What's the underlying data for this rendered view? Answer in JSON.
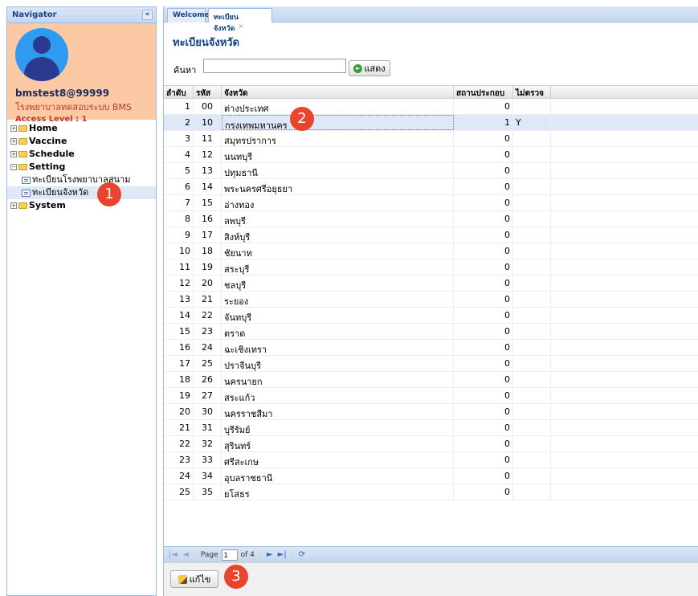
{
  "nav": {
    "title": "Navigator",
    "collapse_icon": "«",
    "username": "bmstest8@99999",
    "hospital": "โรงพยาบาลทดสอบระบบ BMS",
    "access": "Access Level : 1",
    "items": [
      {
        "label": "Home",
        "expanded": false
      },
      {
        "label": "Vaccine",
        "expanded": false
      },
      {
        "label": "Schedule",
        "expanded": false
      },
      {
        "label": "Setting",
        "expanded": true
      },
      {
        "label": "System",
        "expanded": false
      }
    ],
    "setting_children": [
      "ทะเบียนโรงพยาบาลสนาม",
      "ทะเบียนจังหวัด"
    ]
  },
  "tabs": [
    {
      "label": "Welcome"
    },
    {
      "label": "ทะเบียนจังหวัด",
      "close": "×"
    }
  ],
  "page": {
    "title": "ทะเบียนจังหวัด",
    "search_label": "ค้นหา",
    "search_value": "",
    "show_button": "แสดง"
  },
  "grid": {
    "headers": [
      "ลำดับ",
      "รหัส",
      "จังหวัด",
      "สถานประกอบ",
      "ไม่ตรวจ"
    ],
    "rows": [
      [
        "1",
        "00",
        "ต่างประเทศ",
        "0",
        ""
      ],
      [
        "2",
        "10",
        "กรุงเทพมหานคร",
        "1",
        "Y"
      ],
      [
        "3",
        "11",
        "สมุทรปราการ",
        "0",
        ""
      ],
      [
        "4",
        "12",
        "นนทบุรี",
        "0",
        ""
      ],
      [
        "5",
        "13",
        "ปทุมธานี",
        "0",
        ""
      ],
      [
        "6",
        "14",
        "พระนครศรีอยุธยา",
        "0",
        ""
      ],
      [
        "7",
        "15",
        "อ่างทอง",
        "0",
        ""
      ],
      [
        "8",
        "16",
        "ลพบุรี",
        "0",
        ""
      ],
      [
        "9",
        "17",
        "สิงห์บุรี",
        "0",
        ""
      ],
      [
        "10",
        "18",
        "ชัยนาท",
        "0",
        ""
      ],
      [
        "11",
        "19",
        "สระบุรี",
        "0",
        ""
      ],
      [
        "12",
        "20",
        "ชลบุรี",
        "0",
        ""
      ],
      [
        "13",
        "21",
        "ระยอง",
        "0",
        ""
      ],
      [
        "14",
        "22",
        "จันทบุรี",
        "0",
        ""
      ],
      [
        "15",
        "23",
        "ตราด",
        "0",
        ""
      ],
      [
        "16",
        "24",
        "ฉะเชิงเทรา",
        "0",
        ""
      ],
      [
        "17",
        "25",
        "ปราจีนบุรี",
        "0",
        ""
      ],
      [
        "18",
        "26",
        "นครนายก",
        "0",
        ""
      ],
      [
        "19",
        "27",
        "สระแก้ว",
        "0",
        ""
      ],
      [
        "20",
        "30",
        "นครราชสีมา",
        "0",
        ""
      ],
      [
        "21",
        "31",
        "บุรีรัมย์",
        "0",
        ""
      ],
      [
        "22",
        "32",
        "สุรินทร์",
        "0",
        ""
      ],
      [
        "23",
        "33",
        "ศรีสะเกษ",
        "0",
        ""
      ],
      [
        "24",
        "34",
        "อุบลราชธานี",
        "0",
        ""
      ],
      [
        "25",
        "35",
        "ยโสธร",
        "0",
        ""
      ]
    ]
  },
  "pager": {
    "page_label": "Page",
    "page_value": "1",
    "of_label": "of 4"
  },
  "edit_button": "แก้ไข",
  "badges": [
    "1",
    "2",
    "3"
  ]
}
